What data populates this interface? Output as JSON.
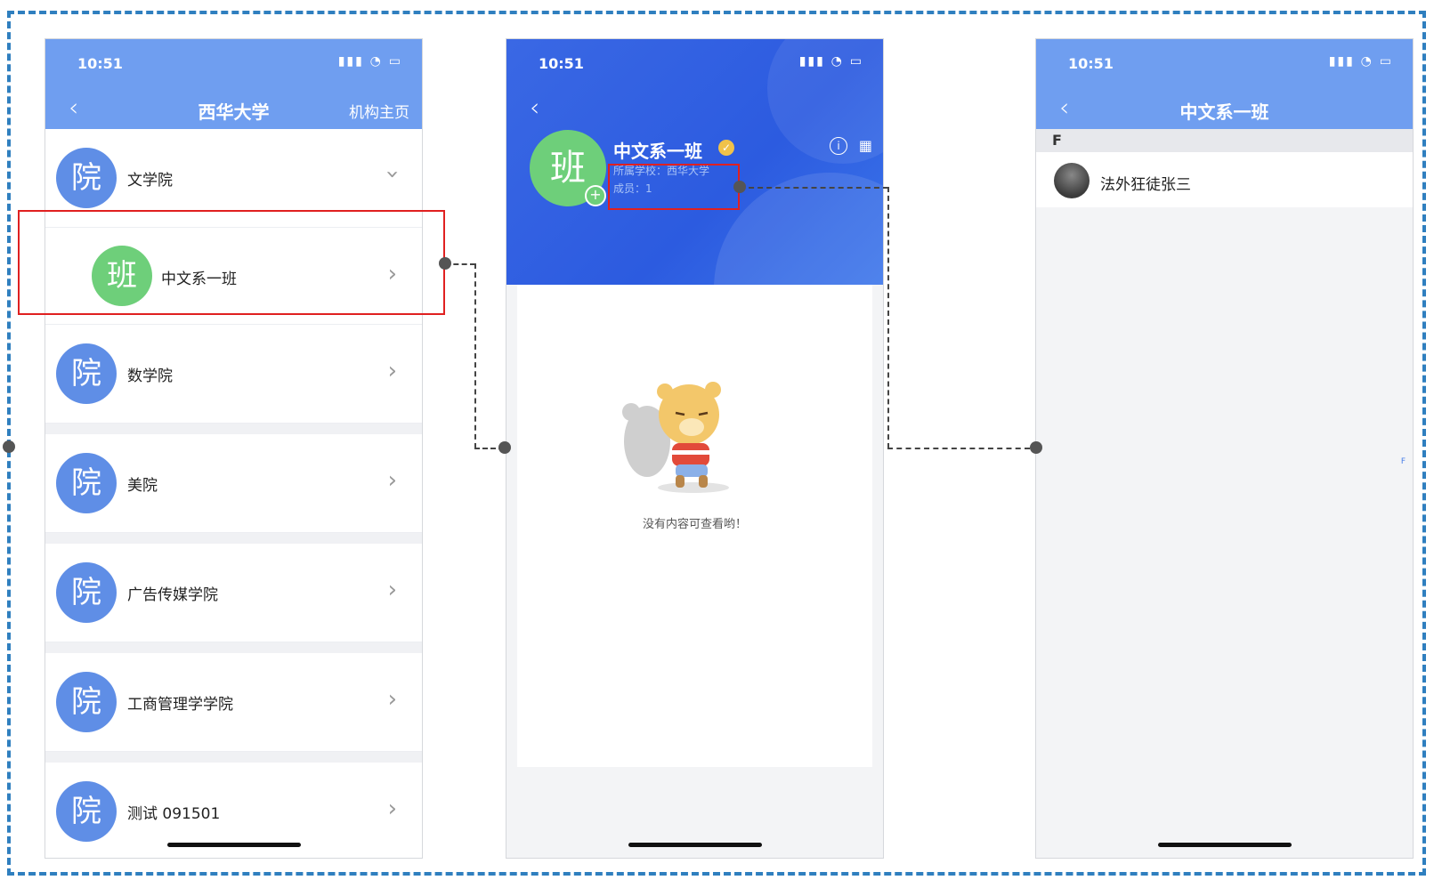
{
  "phone1": {
    "status_time": "10:51",
    "status_icons": "▮▮▮ ◔ ▭",
    "nav": {
      "back": "‹",
      "title": "西华大学",
      "right_action": "机构主页"
    },
    "expanded_item": {
      "avatar_char": "院",
      "label": "文学院"
    },
    "sub_item": {
      "avatar_char": "班",
      "label": "中文系一班"
    },
    "items": [
      {
        "avatar_char": "院",
        "label": "数学院"
      },
      {
        "avatar_char": "院",
        "label": "美院"
      },
      {
        "avatar_char": "院",
        "label": "广告传媒学院"
      },
      {
        "avatar_char": "院",
        "label": "工商管理学学院"
      },
      {
        "avatar_char": "院",
        "label": "测试 091501"
      }
    ],
    "chevron": "›"
  },
  "phone2": {
    "status_time": "10:51",
    "status_icons": "▮▮▮ ◔ ▭",
    "back": "‹",
    "avatar_char": "班",
    "plus": "+",
    "name": "中文系一班",
    "verified": "✓",
    "school_line": "所属学校：西华大学",
    "members_line": "成员：1",
    "info_icon": "i",
    "qr_icon": "▦",
    "empty_text": "没有内容可查看哟！"
  },
  "phone3": {
    "status_time": "10:51",
    "status_icons": "▮▮▮ ◔ ▭",
    "nav": {
      "back": "‹",
      "title": "中文系一班"
    },
    "section_letter": "F",
    "member_name": "法外狂徒张三",
    "index_letter": "F"
  },
  "colors": {
    "frame_border": "#2f7fbf",
    "nav_blue": "#6f9ef0",
    "header_blue": "#2c5be0",
    "avatar_blue": "#5f8ee6",
    "avatar_green": "#6ecf7a",
    "highlight_red": "#e02020"
  }
}
